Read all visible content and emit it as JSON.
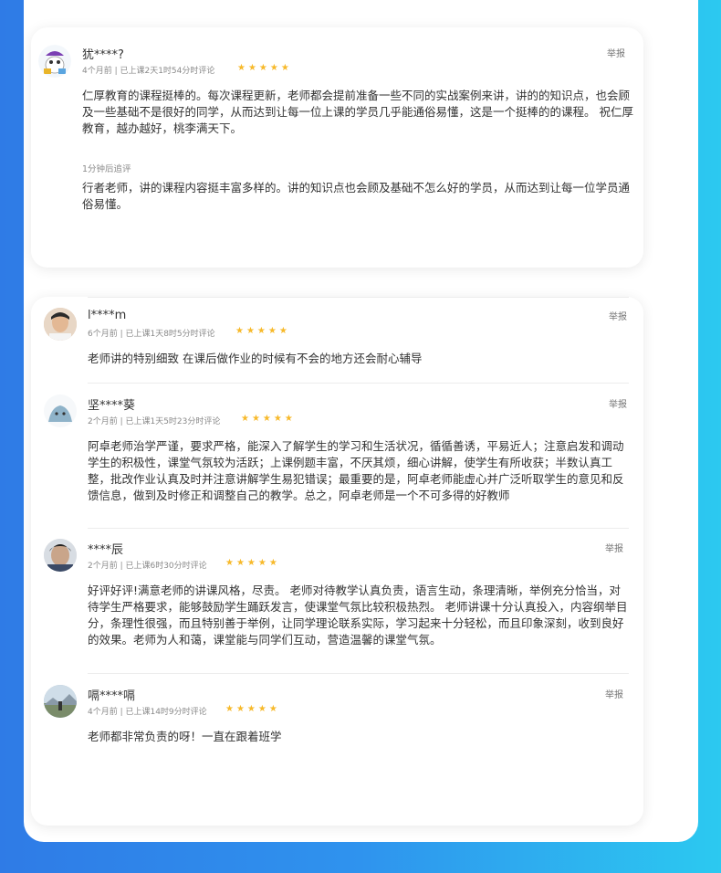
{
  "reviews_card1": [
    {
      "user": "犹****?",
      "meta": "4个月前 | 已上课2天1时54分时评论",
      "stars": "★★★★★",
      "report": "举报",
      "text": "仁厚教育的课程挺棒的。每次课程更新，老师都会提前准备一些不同的实战案例来讲，讲的的知识点，也会顾及一些基础不是很好的同学，从而达到让每一位上课的学员几乎能通俗易懂，这是一个挺棒的的课程。 祝仁厚教育，越办越好，桃李满天下。",
      "follow_label": "1分钟后追评",
      "follow_text": "行者老师，讲的课程内容挺丰富多样的。讲的知识点也会顾及基础不怎么好的学员，从而达到让每一位学员通俗易懂。"
    }
  ],
  "reviews_card2": [
    {
      "user": "l****m",
      "meta": "6个月前 | 已上课1天8时5分时评论",
      "stars": "★★★★★",
      "report": "举报",
      "text": "老师讲的特别细致 在课后做作业的时候有不会的地方还会耐心辅导"
    },
    {
      "user": "坚****葵",
      "meta": "2个月前 | 已上课1天5时23分时评论",
      "stars": "★★★★★",
      "report": "举报",
      "text": "阿卓老师治学严谨，要求严格，能深入了解学生的学习和生活状况，循循善诱，平易近人；注意启发和调动学生的积极性，课堂气氛较为活跃；上课例题丰富，不厌其烦，细心讲解，使学生有所收获；半数认真工整，批改作业认真及时并注意讲解学生易犯错误；最重要的是，阿卓老师能虚心并广泛听取学生的意见和反馈信息，做到及时修正和调整自己的教学。总之，阿卓老师是一个不可多得的好教师"
    },
    {
      "user": "****辰",
      "meta": "2个月前 | 已上课6时30分时评论",
      "stars": "★★★★★",
      "report": "举报",
      "text": "好评好评!满意老师的讲课风格，尽责。 老师对待教学认真负责，语言生动，条理清晰，举例充分恰当，对待学生严格要求，能够鼓励学生踊跃发言，使课堂气氛比较积极热烈。 老师讲课十分认真投入，内容纲举目分，条理性很强，而且特别善于举例，让同学理论联系实际，学习起来十分轻松，而且印象深刻，收到良好的效果。老师为人和蔼，课堂能与同学们互动，营造温馨的课堂气氛。"
    },
    {
      "user": "嗝****嗝",
      "meta": "4个月前 | 已上课14时9分时评论",
      "stars": "★★★★★",
      "report": "举报",
      "text": "老师都非常负责的呀！一直在跟着班学"
    }
  ],
  "colors": {
    "star": "#f7b92a",
    "bg_left": "#2f7be6",
    "bg_right": "#2cc9f0"
  }
}
